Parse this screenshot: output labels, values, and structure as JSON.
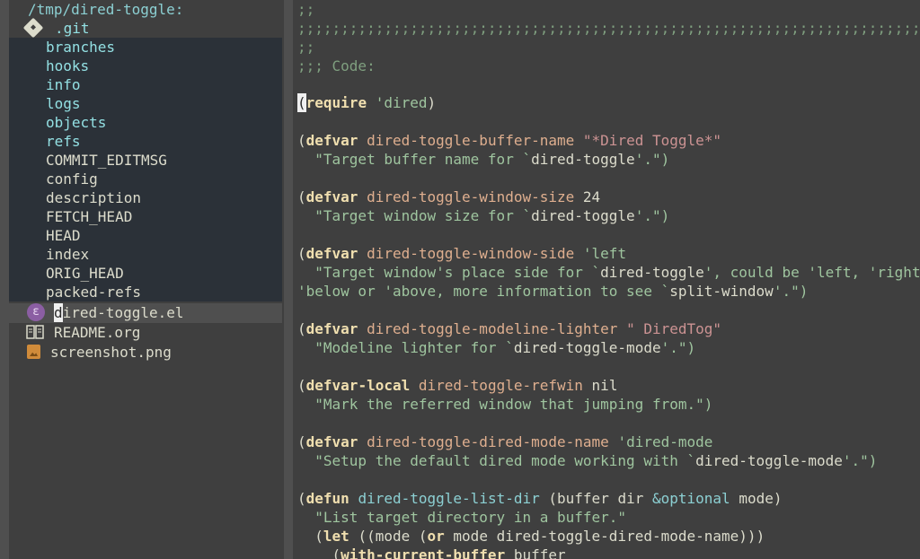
{
  "sidebar": {
    "path": "/tmp/dired-toggle:",
    "git_folder": ".git",
    "git_children": [
      {
        "name": "branches",
        "type": "dir"
      },
      {
        "name": "hooks",
        "type": "dir"
      },
      {
        "name": "info",
        "type": "dir"
      },
      {
        "name": "logs",
        "type": "dir"
      },
      {
        "name": "objects",
        "type": "dir"
      },
      {
        "name": "refs",
        "type": "dir"
      },
      {
        "name": "COMMIT_EDITMSG",
        "type": "file"
      },
      {
        "name": "config",
        "type": "file"
      },
      {
        "name": "description",
        "type": "file"
      },
      {
        "name": "FETCH_HEAD",
        "type": "file"
      },
      {
        "name": "HEAD",
        "type": "file"
      },
      {
        "name": "index",
        "type": "file"
      },
      {
        "name": "ORIG_HEAD",
        "type": "file"
      },
      {
        "name": "packed-refs",
        "type": "file"
      }
    ],
    "files": {
      "el_cursor_char": "d",
      "el_rest": "ired-toggle.el",
      "readme": "README.org",
      "screenshot": "screenshot.png"
    },
    "icons": [
      "git-icon",
      "emacs-lisp-icon",
      "book-icon",
      "image-icon"
    ]
  },
  "editor": {
    "comment_1": ";;",
    "comment_2": ";;;;;;;;;;;;;;;;;;;;;;;;;;;;;;;;;;;;;;;;;;;;;;;;;;;;;;;;;;;;;;;;;;;;;;;;;;;;;;",
    "comment_3": ";;",
    "comment_4": ";;; Code:",
    "require_line": {
      "cursor": "(",
      "kw": "require",
      "quoted": "'dired",
      "close": ")"
    },
    "forms": [
      {
        "kw": "defvar",
        "name": "dired-toggle-buffer-name",
        "value": "\"*Dired Toggle*\"",
        "doc_pre": "\"Target buffer name for `",
        "doc_ref": "dired-toggle",
        "doc_post": "'.\")"
      },
      {
        "kw": "defvar",
        "name": "dired-toggle-window-size",
        "value": "24",
        "doc_pre": "\"Target window size for `",
        "doc_ref": "dired-toggle",
        "doc_post": "'.\")"
      },
      {
        "kw": "defvar",
        "name": "dired-toggle-window-side",
        "value": "'left",
        "doc_pre": "\"Target window's place side for `",
        "doc_ref": "dired-toggle",
        "doc_post": "', could be 'left, 'right,",
        "doc2_pre": "'below or 'above, more information to see `",
        "doc2_ref": "split-window",
        "doc2_post": "'.\")"
      },
      {
        "kw": "defvar",
        "name": "dired-toggle-modeline-lighter",
        "value": "\" DiredTog\"",
        "doc_pre": "\"Modeline lighter for `",
        "doc_ref": "dired-toggle-mode",
        "doc_post": "'.\")"
      },
      {
        "kw": "defvar-local",
        "name": "dired-toggle-refwin",
        "value": "nil",
        "doc": "\"Mark the referred window that jumping from.\")"
      },
      {
        "kw": "defvar",
        "name": "dired-toggle-dired-mode-name",
        "value": "'dired-mode",
        "doc_pre": "\"Setup the default dired mode working with `",
        "doc_ref": "dired-toggle-mode",
        "doc_post": "'.\")"
      }
    ],
    "defun": {
      "kw": "defun",
      "name": "dired-toggle-list-dir",
      "args_pre": "(buffer dir ",
      "optional": "&optional",
      "args_post": " mode)",
      "doc": "\"List target directory in a buffer.\"",
      "let_kw": "let",
      "let_mid": " ((mode (",
      "or_kw": "or",
      "let_post": " mode dired-toggle-dired-mode-name)))",
      "wcb_kw": "with-current-buffer",
      "wcb_post": " buffer"
    }
  }
}
